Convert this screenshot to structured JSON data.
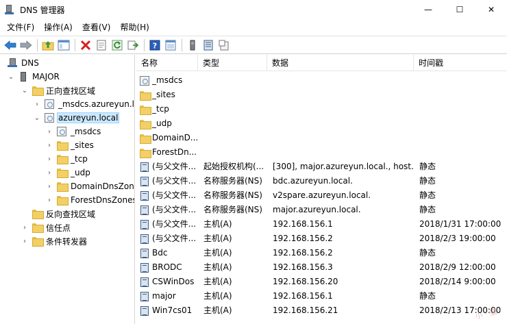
{
  "window": {
    "title": "DNS 管理器",
    "controls": {
      "minimize": "—",
      "maximize": "☐",
      "close": "✕"
    }
  },
  "menu": [
    "文件(F)",
    "操作(A)",
    "查看(V)",
    "帮助(H)"
  ],
  "toolbar": [
    "back-icon",
    "forward-icon",
    "sep",
    "up-folder-icon",
    "show-hide-tree-icon",
    "sep",
    "delete-icon",
    "properties-icon",
    "refresh-icon",
    "export-list-icon",
    "sep",
    "help-icon",
    "console-icon",
    "sep",
    "new-host-icon",
    "new-record-icon",
    "new-alias-icon"
  ],
  "tree": [
    {
      "label": "DNS",
      "icon": "dns-icon",
      "depth": 0,
      "chevron": ""
    },
    {
      "label": "MAJOR",
      "icon": "server-icon",
      "depth": 1,
      "chevron": "open"
    },
    {
      "label": "正向查找区域",
      "icon": "folder-icon",
      "depth": 2,
      "chevron": "open"
    },
    {
      "label": "_msdcs.azureyun.local",
      "icon": "zone-icon",
      "depth": 3,
      "chevron": "closed"
    },
    {
      "label": "azureyun.local",
      "icon": "zone-icon",
      "depth": 3,
      "chevron": "open",
      "selected": true
    },
    {
      "label": "_msdcs",
      "icon": "zone-icon",
      "depth": 4,
      "chevron": "closed"
    },
    {
      "label": "_sites",
      "icon": "folder-icon",
      "depth": 4,
      "chevron": "closed"
    },
    {
      "label": "_tcp",
      "icon": "folder-icon",
      "depth": 4,
      "chevron": "closed"
    },
    {
      "label": "_udp",
      "icon": "folder-icon",
      "depth": 4,
      "chevron": "closed"
    },
    {
      "label": "DomainDnsZones",
      "icon": "folder-icon",
      "depth": 4,
      "chevron": "closed"
    },
    {
      "label": "ForestDnsZones",
      "icon": "folder-icon",
      "depth": 4,
      "chevron": "closed"
    },
    {
      "label": "反向查找区域",
      "icon": "folder-icon",
      "depth": 2,
      "chevron": ""
    },
    {
      "label": "信任点",
      "icon": "folder-icon",
      "depth": 2,
      "chevron": "closed"
    },
    {
      "label": "条件转发器",
      "icon": "folder-icon",
      "depth": 2,
      "chevron": "closed"
    }
  ],
  "list": {
    "columns": [
      "名称",
      "类型",
      "数据",
      "时间戳"
    ],
    "rows": [
      {
        "name": "_msdcs",
        "type": "",
        "data": "",
        "time": "",
        "icon": "zone-icon"
      },
      {
        "name": "_sites",
        "type": "",
        "data": "",
        "time": "",
        "icon": "folder-icon"
      },
      {
        "name": "_tcp",
        "type": "",
        "data": "",
        "time": "",
        "icon": "folder-icon"
      },
      {
        "name": "_udp",
        "type": "",
        "data": "",
        "time": "",
        "icon": "folder-icon"
      },
      {
        "name": "DomainD...",
        "type": "",
        "data": "",
        "time": "",
        "icon": "folder-icon"
      },
      {
        "name": "ForestDn...",
        "type": "",
        "data": "",
        "time": "",
        "icon": "folder-icon"
      },
      {
        "name": "(与父文件...",
        "type": "起始授权机构(...",
        "data": "[300], major.azureyun.local., host...",
        "time": "静态",
        "icon": "record-icon"
      },
      {
        "name": "(与父文件...",
        "type": "名称服务器(NS)",
        "data": "bdc.azureyun.local.",
        "time": "静态",
        "icon": "record-icon"
      },
      {
        "name": "(与父文件...",
        "type": "名称服务器(NS)",
        "data": "v2spare.azureyun.local.",
        "time": "静态",
        "icon": "record-icon"
      },
      {
        "name": "(与父文件...",
        "type": "名称服务器(NS)",
        "data": "major.azureyun.local.",
        "time": "静态",
        "icon": "record-icon"
      },
      {
        "name": "(与父文件...",
        "type": "主机(A)",
        "data": "192.168.156.1",
        "time": "2018/1/31 17:00:00",
        "icon": "record-icon"
      },
      {
        "name": "(与父文件...",
        "type": "主机(A)",
        "data": "192.168.156.2",
        "time": "2018/2/3 19:00:00",
        "icon": "record-icon"
      },
      {
        "name": "Bdc",
        "type": "主机(A)",
        "data": "192.168.156.2",
        "time": "静态",
        "icon": "record-icon"
      },
      {
        "name": "BRODC",
        "type": "主机(A)",
        "data": "192.168.156.3",
        "time": "2018/2/9 12:00:00",
        "icon": "record-icon"
      },
      {
        "name": "CSWinDos",
        "type": "主机(A)",
        "data": "192.168.156.20",
        "time": "2018/2/14 9:00:00",
        "icon": "record-icon"
      },
      {
        "name": "major",
        "type": "主机(A)",
        "data": "192.168.156.1",
        "time": "静态",
        "icon": "record-icon"
      },
      {
        "name": "Win7cs01",
        "type": "主机(A)",
        "data": "192.168.156.21",
        "time": "2018/2/13 17:00:00",
        "icon": "record-icon"
      }
    ]
  }
}
